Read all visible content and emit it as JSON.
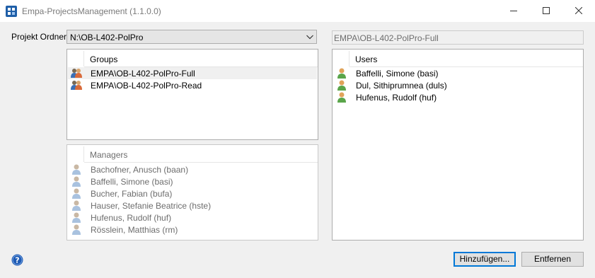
{
  "window": {
    "title": "Empa-ProjectsManagement (1.1.0.0)",
    "controls": [
      "minimize-icon",
      "maximize-icon",
      "close-icon"
    ]
  },
  "folder": {
    "label": "Projekt Ordner:",
    "selected": "N:\\OB-L402-PolPro",
    "selected_group_path": "EMPA\\OB-L402-PolPro-Full"
  },
  "groups": {
    "header": "Groups",
    "items": [
      {
        "name": "EMPA\\OB-L402-PolPro-Full",
        "selected": true
      },
      {
        "name": "EMPA\\OB-L402-PolPro-Read",
        "selected": false
      }
    ]
  },
  "users": {
    "header": "Users",
    "items": [
      "Baffelli, Simone (basi)",
      "Dul, Sithiprumnea (duls)",
      "Hufenus, Rudolf (huf)"
    ]
  },
  "managers": {
    "header": "Managers",
    "items": [
      "Bachofner, Anusch (baan)",
      "Baffelli, Simone (basi)",
      "Bucher, Fabian (bufa)",
      "Hauser, Stefanie Beatrice (hste)",
      "Hufenus, Rudolf (huf)",
      "Rösslein, Matthias (rm)"
    ]
  },
  "buttons": {
    "add": "Hinzufügen...",
    "remove": "Entfernen"
  },
  "colors": {
    "accent": "#0078d7",
    "help_icon": "#1e5bb5"
  }
}
